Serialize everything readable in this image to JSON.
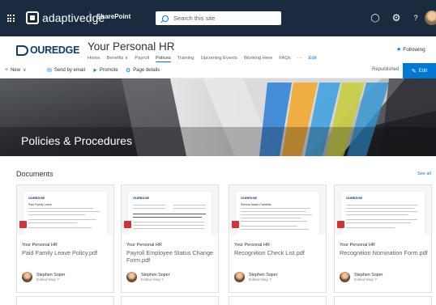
{
  "suite_bar": {
    "brand": "adaptivedge",
    "product": "SharePoint",
    "search_placeholder": "Search this site",
    "icons": [
      "waffle-icon",
      "bell-icon",
      "gear-icon",
      "help-icon",
      "avatar"
    ]
  },
  "site": {
    "logo_text": "OUREDGE",
    "title": "Your Personal HR",
    "nav": [
      "Home",
      "Benefits",
      "Payroll",
      "Polices",
      "Training",
      "Upcoming Events",
      "Working Here",
      "FAQs",
      "···",
      "Edit"
    ],
    "active_nav": "Polices",
    "following_label": "Following"
  },
  "command_bar": {
    "new_label": "New",
    "send_label": "Send by email",
    "promote_label": "Promote",
    "details_label": "Page details",
    "status": "Republished",
    "edit_label": "Edit"
  },
  "hero": {
    "title": "Policies & Procedures"
  },
  "documents": {
    "heading": "Documents",
    "see_all": "See all",
    "cards": [
      {
        "site": "Your Personal HR",
        "name": "Paid Family Leave Policy.pdf",
        "author": "Stephen Soper",
        "edited": "Edited May 7",
        "thumb_heading": "Paid Family Leave"
      },
      {
        "site": "Your Personal HR",
        "name": "Payroll Employee Status Change Form.pdf",
        "author": "Stephen Soper",
        "edited": "Edited May 7",
        "thumb_heading": ""
      },
      {
        "site": "Your Personal HR",
        "name": "Recognition Check List.pdf",
        "author": "Stephen Soper",
        "edited": "Edited May 7",
        "thumb_heading": "Service Award Checklist"
      },
      {
        "site": "Your Personal HR",
        "name": "Recognition Nomination Form.pdf",
        "author": "Stephen Soper",
        "edited": "Edited May 7",
        "thumb_heading": ""
      }
    ]
  },
  "colors": {
    "suite_bar": "#1b2b3f",
    "accent": "#0078d4",
    "logo": "#0d3c6d"
  }
}
